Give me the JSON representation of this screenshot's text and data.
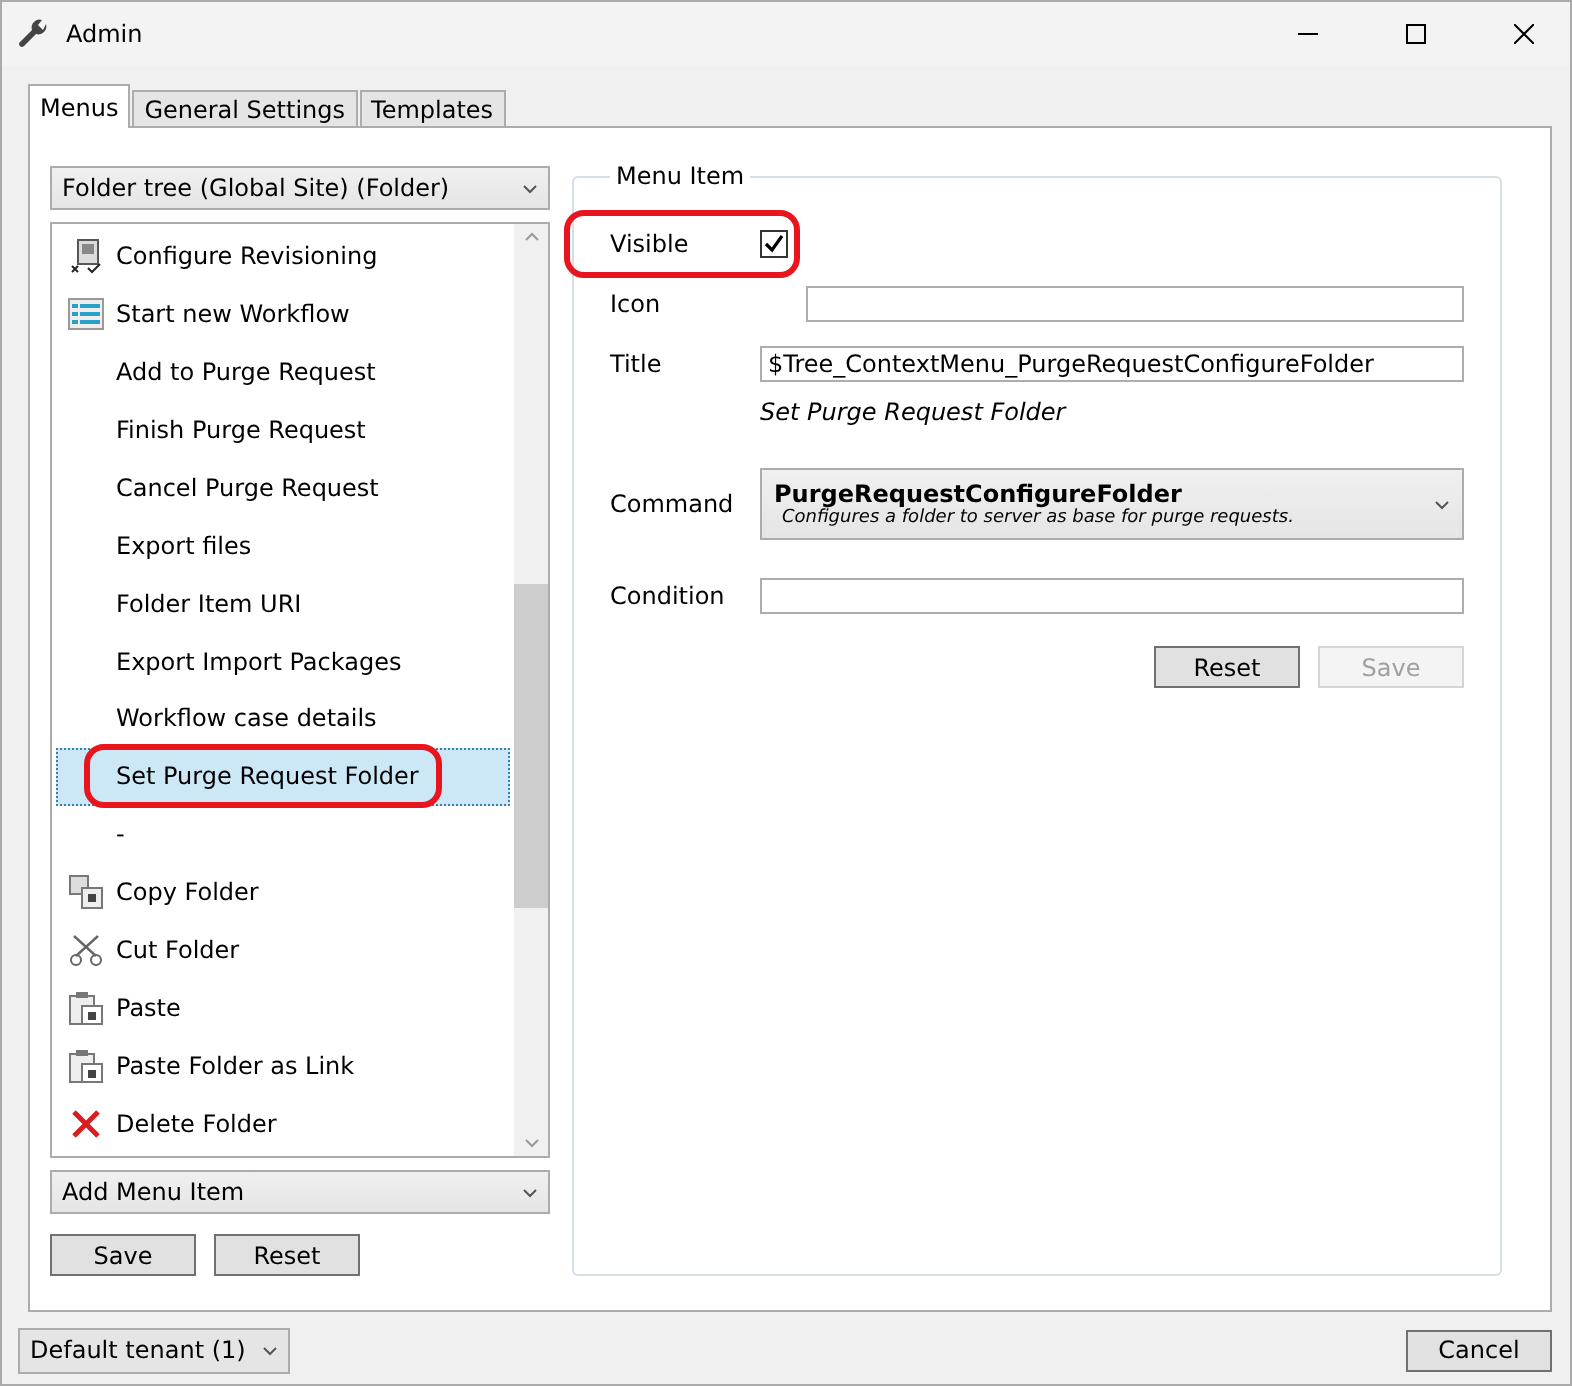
{
  "window": {
    "title": "Admin"
  },
  "tabs": [
    {
      "label": "Menus",
      "selected": true
    },
    {
      "label": "General Settings",
      "selected": false
    },
    {
      "label": "Templates",
      "selected": false
    }
  ],
  "menu_selector": {
    "value": "Folder tree (Global Site) (Folder)"
  },
  "menu_items": [
    {
      "label": "Configure Revisioning",
      "kind": "revisioning",
      "selected": false
    },
    {
      "label": "Start new Workflow",
      "kind": "workflow",
      "selected": false
    },
    {
      "label": "Add to Purge Request",
      "kind": "plain",
      "selected": false
    },
    {
      "label": "Finish Purge Request",
      "kind": "plain",
      "selected": false
    },
    {
      "label": "Cancel Purge Request",
      "kind": "plain",
      "selected": false
    },
    {
      "label": "Export files",
      "kind": "plain",
      "selected": false
    },
    {
      "label": "Folder Item URI",
      "kind": "plain",
      "selected": false
    },
    {
      "label": "Export Import Packages",
      "kind": "plain",
      "selected": false
    },
    {
      "label": "Workflow case details",
      "kind": "plain",
      "selected": false
    },
    {
      "label": "Set Purge Request Folder",
      "kind": "plain",
      "selected": true,
      "highlighted": true
    },
    {
      "label": "-",
      "kind": "plain",
      "selected": false
    },
    {
      "label": "Copy Folder",
      "kind": "copy",
      "selected": false
    },
    {
      "label": "Cut Folder",
      "kind": "cut",
      "selected": false
    },
    {
      "label": "Paste",
      "kind": "paste",
      "selected": false
    },
    {
      "label": "Paste Folder as Link",
      "kind": "paste",
      "selected": false
    },
    {
      "label": "Delete Folder",
      "kind": "delete",
      "selected": false
    }
  ],
  "add_menu_item": {
    "value": "Add Menu Item"
  },
  "left_buttons": [
    {
      "label": "Save",
      "disabled": false
    },
    {
      "label": "Reset",
      "disabled": false
    }
  ],
  "menu_item": {
    "legend": "Menu Item",
    "visible": {
      "label": "Visible",
      "checked": true,
      "highlighted": true
    },
    "icon": {
      "label": "Icon"
    },
    "title": {
      "label": "Title",
      "value": "$Tree_ContextMenu_PurgeRequestConfigureFolder",
      "hint": "Set Purge Request Folder"
    },
    "command": {
      "label": "Command",
      "value": "PurgeRequestConfigureFolder",
      "description": "Configures a folder to server as base for purge requests."
    },
    "condition": {
      "label": "Condition"
    },
    "buttons": [
      {
        "label": "Reset",
        "disabled": false
      },
      {
        "label": "Save",
        "disabled": true
      }
    ]
  },
  "tenant": {
    "value": "Default tenant (1)"
  },
  "cancel_button": {
    "label": "Cancel"
  }
}
